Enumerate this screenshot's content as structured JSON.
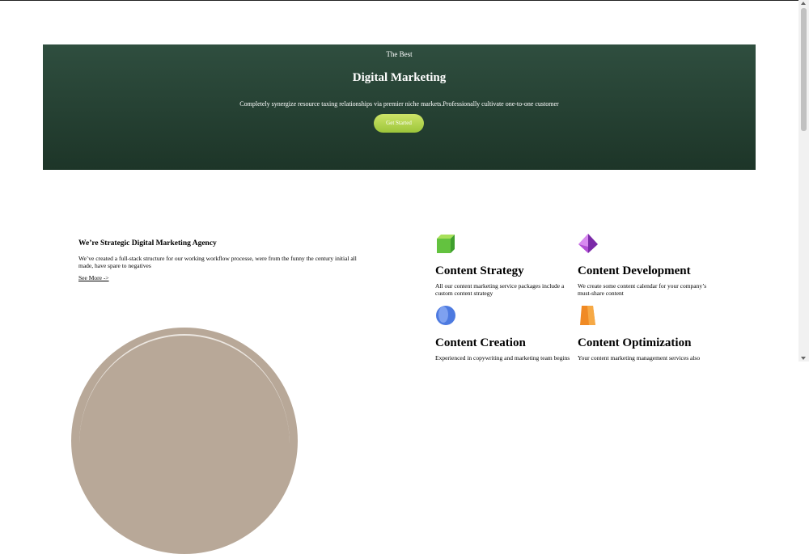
{
  "hero": {
    "eyebrow": "The Best",
    "title": "Digital Marketing",
    "description": "Completely synergize resource taxing relationships via premier niche markets.Professionally cultivate one-to-one customer",
    "cta_label": "Get Started",
    "colors": {
      "background_top": "#2f4e3f",
      "background_bottom": "#1d3528",
      "cta": "#b6d84f"
    }
  },
  "agency": {
    "heading": "We’re Strategic Digital Marketing Agency",
    "text": "We’ve created a full-stack structure for our working workflow processe, were from the funny the century initial all made, have spare to negatives",
    "link_label": "See More ->"
  },
  "services": [
    {
      "icon": "green-cube-icon",
      "title": "Content Strategy",
      "text": "All our content marketing service packages include a custom content strategy"
    },
    {
      "icon": "purple-pyramid-icon",
      "title": "Content Development",
      "text": "We create some content calendar for your company’s must-share content"
    },
    {
      "icon": "blue-sphere-icon",
      "title": "Content Creation",
      "text": "Experienced in copywriting and marketing team begins"
    },
    {
      "icon": "orange-cylinder-icon",
      "title": "Content Optimization",
      "text": "Your content marketing management services also"
    }
  ]
}
